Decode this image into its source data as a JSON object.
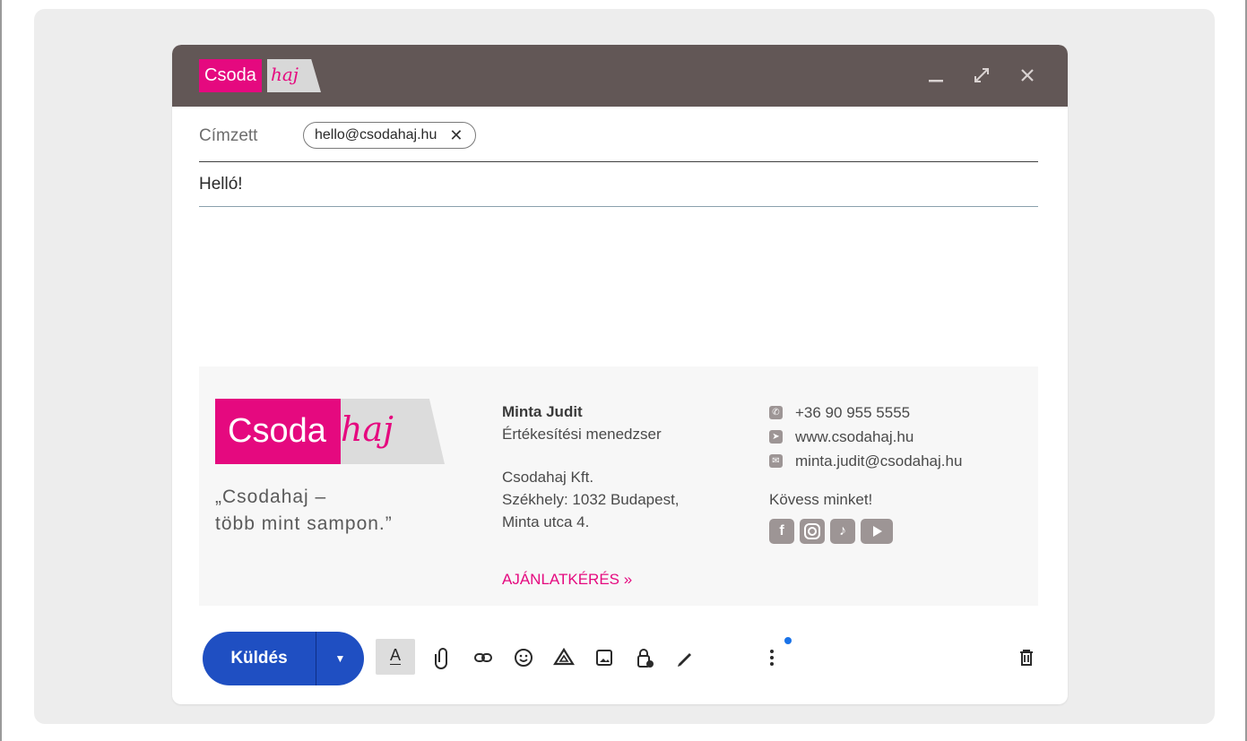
{
  "window": {
    "brand_main": "Csoda",
    "brand_script": "haj",
    "minimize_icon": "minimize-icon",
    "expand_icon": "expand-icon",
    "close_icon": "close-icon"
  },
  "recipients": {
    "label": "Címzett",
    "chips": [
      {
        "email": "hello@csodahaj.hu",
        "remove": "✕"
      }
    ]
  },
  "subject": "Helló!",
  "signature": {
    "logo_main": "Csoda",
    "logo_script": "haj",
    "quote_line1": "„Csodahaj –",
    "quote_line2": "több mint sampon.”",
    "name": "Minta Judit",
    "role": "Értékesítési menedzser",
    "company": "Csodahaj Kft.",
    "address_line1": "Székhely: 1032 Budapest,",
    "address_line2": "Minta utca 4.",
    "cta": "AJÁNLATKÉRÉS »",
    "phone": "+36 90 955 5555",
    "website": "www.csodahaj.hu",
    "email": "minta.judit@csodahaj.hu",
    "follow": "Kövess minket!",
    "socials": [
      "facebook-icon",
      "instagram-icon",
      "tiktok-icon",
      "youtube-icon"
    ]
  },
  "toolbar": {
    "send_label": "Küldés",
    "tools": [
      "text-format-icon",
      "attach-icon",
      "link-icon",
      "emoji-icon",
      "drive-icon",
      "photo-icon",
      "confidential-icon",
      "signature-icon",
      "more-options-icon",
      "delete-icon"
    ]
  },
  "colors": {
    "brand_pink": "#e5097f",
    "titlebar": "#625756",
    "send_blue": "#1f4fc2"
  }
}
